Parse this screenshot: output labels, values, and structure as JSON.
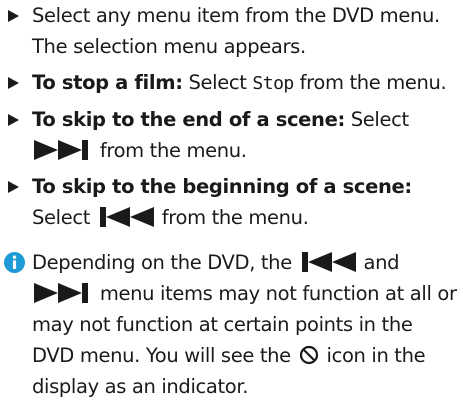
{
  "steps": [
    {
      "text": "Select any menu item from the DVD menu. The selection menu appears."
    },
    {
      "lead": "To stop a film:",
      "pre": " Select ",
      "mono": "Stop",
      "post": " from the menu."
    },
    {
      "lead": "To skip to the end of a scene:",
      "pre": " Select",
      "icon": "skip-forward-icon",
      "post": " from the menu."
    },
    {
      "lead": "To skip to the beginning of a scene:",
      "pre": "Select ",
      "icon": "skip-back-icon",
      "post": " from the menu."
    }
  ],
  "note": {
    "icon": "info-icon",
    "part1": "Depending on the DVD, the ",
    "part2": " and",
    "part3": " menu items may not function at all or may not function at certain points in the DVD menu. You will see the ",
    "part4": " icon in the display as an indicator."
  },
  "colors": {
    "info_blue": "#1e9ad6",
    "text": "#1a1a1a"
  }
}
